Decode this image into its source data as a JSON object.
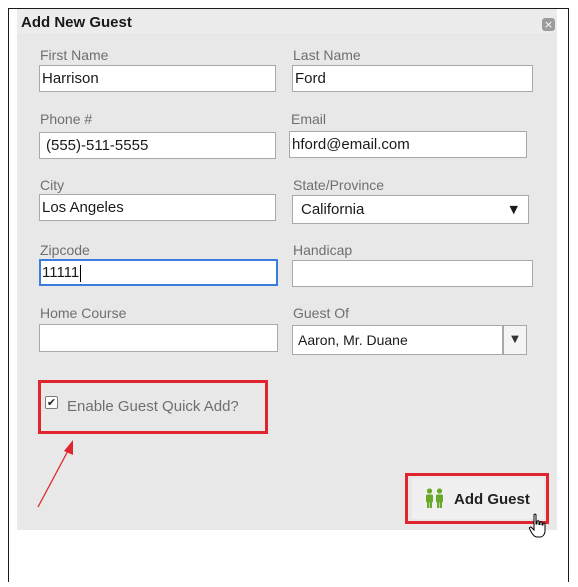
{
  "dialog": {
    "title": "Add New Guest",
    "close_glyph": "×"
  },
  "form": {
    "first_name": {
      "label": "First Name",
      "value": "Harrison"
    },
    "last_name": {
      "label": "Last Name",
      "value": "Ford"
    },
    "phone": {
      "label": "Phone #",
      "value": "(555)-511-5555"
    },
    "email": {
      "label": "Email",
      "value": "hford@email.com"
    },
    "city": {
      "label": "City",
      "value": "Los Angeles"
    },
    "state": {
      "label": "State/Province",
      "value": "California",
      "arrow": "▼"
    },
    "zipcode": {
      "label": "Zipcode",
      "value": "11111"
    },
    "handicap": {
      "label": "Handicap",
      "value": ""
    },
    "home_course": {
      "label": "Home Course",
      "value": ""
    },
    "guest_of": {
      "label": "Guest Of",
      "value": "Aaron, Mr. Duane",
      "arrow": "▼"
    },
    "quick_add": {
      "label": "Enable Guest Quick Add?",
      "checked": true,
      "check_glyph": "✔"
    }
  },
  "actions": {
    "add_guest_label": "Add Guest",
    "add_guest_icon": "people-icon"
  },
  "annotations": {
    "highlight_color": "#e0252e"
  }
}
